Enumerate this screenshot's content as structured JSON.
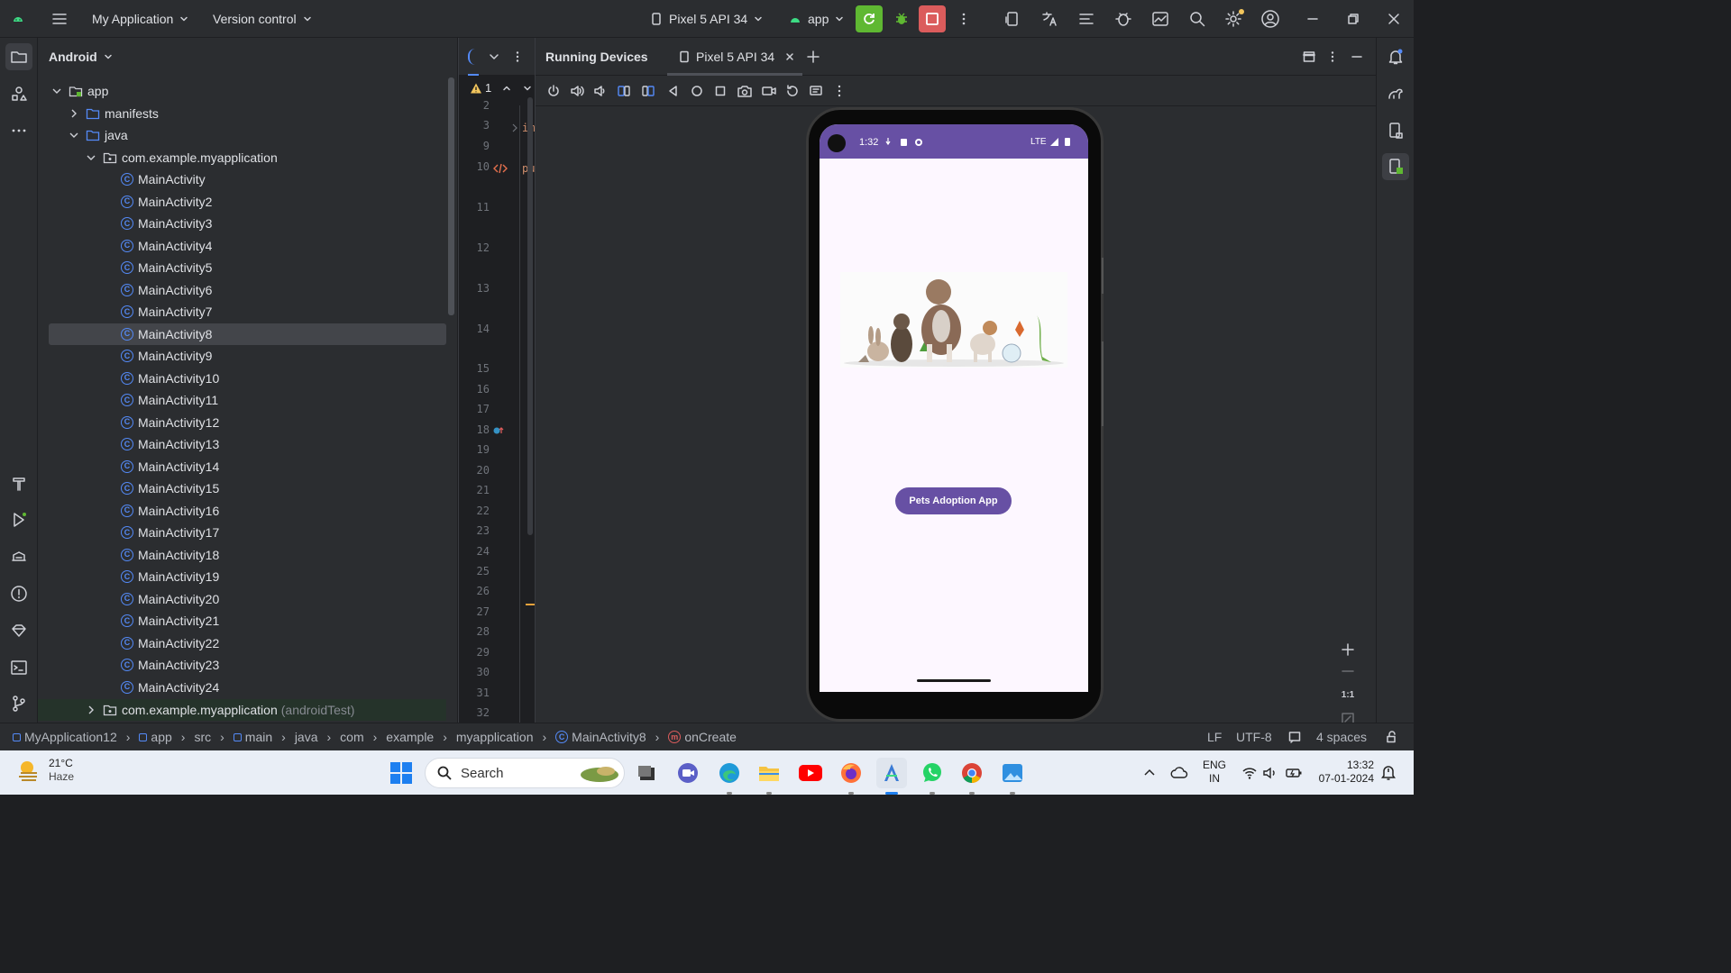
{
  "titlebar": {
    "project": "My Application",
    "vcs": "Version control",
    "device": "Pixel 5 API 34",
    "run_config": "app"
  },
  "project_panel": {
    "view": "Android",
    "tree": {
      "app": "app",
      "manifests": "manifests",
      "java": "java",
      "package": "com.example.myapplication",
      "classes": [
        "MainActivity",
        "MainActivity2",
        "MainActivity3",
        "MainActivity4",
        "MainActivity5",
        "MainActivity6",
        "MainActivity7",
        "MainActivity8",
        "MainActivity9",
        "MainActivity10",
        "MainActivity11",
        "MainActivity12",
        "MainActivity13",
        "MainActivity14",
        "MainActivity15",
        "MainActivity16",
        "MainActivity17",
        "MainActivity18",
        "MainActivity19",
        "MainActivity20",
        "MainActivity21",
        "MainActivity22",
        "MainActivity23",
        "MainActivity24"
      ],
      "selected": "MainActivity8",
      "test_package": "com.example.myapplication",
      "test_suffix": "(androidTest)"
    }
  },
  "editor": {
    "warning_count": "1",
    "line_numbers": [
      "2",
      "3",
      "9",
      "10",
      "11",
      "12",
      "13",
      "14",
      "15",
      "16",
      "17",
      "18",
      "19",
      "20",
      "21",
      "22",
      "23",
      "24",
      "25",
      "26",
      "27",
      "28",
      "29",
      "30",
      "31",
      "32"
    ],
    "code_fragments": [
      "im",
      "pu"
    ]
  },
  "running_devices": {
    "title": "Running Devices",
    "tab": "Pixel 5 API 34",
    "zoom_label": "1:1"
  },
  "phone": {
    "time": "1:32",
    "network": "LTE",
    "button_label": "Pets Adoption App"
  },
  "status_bar": {
    "breadcrumbs": [
      "MyApplication12",
      "app",
      "src",
      "main",
      "java",
      "com",
      "example",
      "myapplication",
      "MainActivity8",
      "onCreate"
    ],
    "line_sep": "LF",
    "encoding": "UTF-8",
    "indent": "4 spaces"
  },
  "taskbar": {
    "temp": "21°C",
    "weather": "Haze",
    "search": "Search",
    "lang1": "ENG",
    "lang2": "IN",
    "time": "13:32",
    "date": "07-01-2024"
  },
  "colors": {
    "accent": "#6750a4",
    "run_green": "#5fb832",
    "stop_red": "#db5c5c",
    "class_blue": "#548af7"
  }
}
